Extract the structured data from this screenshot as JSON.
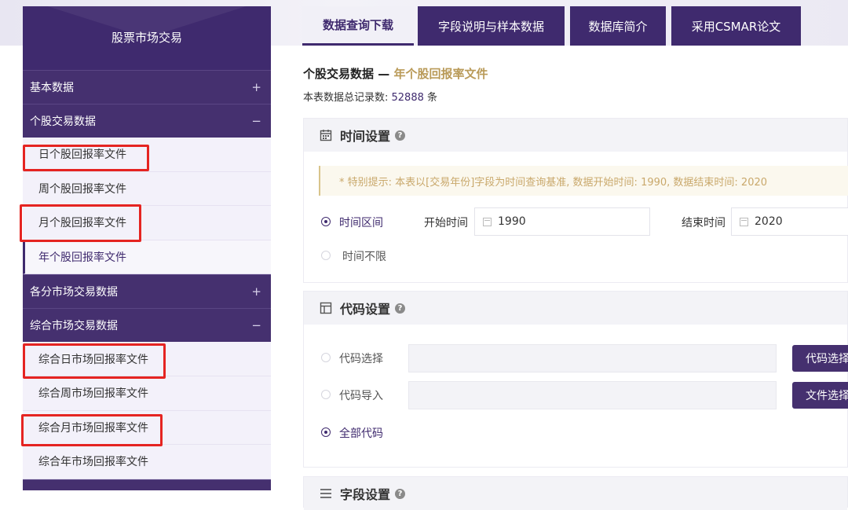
{
  "sidebar": {
    "title": "股票市场交易",
    "groups": [
      {
        "label": "基本数据",
        "sign": "+"
      },
      {
        "label": "个股交易数据",
        "sign": "−"
      },
      {
        "label": "各分市场交易数据",
        "sign": "+"
      },
      {
        "label": "综合市场交易数据",
        "sign": "−"
      }
    ],
    "items": [
      "日个股回报率文件",
      "周个股回报率文件",
      "月个股回报率文件",
      "年个股回报率文件",
      "综合日市场回报率文件",
      "综合周市场回报率文件",
      "综合月市场回报率文件",
      "综合年市场回报率文件"
    ]
  },
  "tabs": [
    "数据查询下载",
    "字段说明与样本数据",
    "数据库简介",
    "采用CSMAR论文"
  ],
  "heading": {
    "title_prefix": "个股交易数据 — ",
    "title_accent": "年个股回报率文件",
    "count_label": "本表数据总记录数: ",
    "count_value": "52888",
    "count_unit": " 条"
  },
  "time_panel": {
    "title": "时间设置",
    "notice": "* 特别提示: 本表以[交易年份]字段为时间查询基准, 数据开始时间: 1990, 数据结束时间: 2020",
    "option_range": "时间区间",
    "option_unlimited": "时间不限",
    "start_label": "开始时间",
    "start_value": "1990",
    "end_label": "结束时间",
    "end_value": "2020"
  },
  "code_panel": {
    "title": "代码设置",
    "option_select": "代码选择",
    "option_import": "代码导入",
    "option_all": "全部代码",
    "select_button": "代码选择",
    "file_button": "文件选择"
  },
  "field_panel": {
    "title": "字段设置"
  },
  "colors": {
    "brand": "#3f2a6e",
    "accent": "#b99a58",
    "highlight": "#e52421"
  }
}
